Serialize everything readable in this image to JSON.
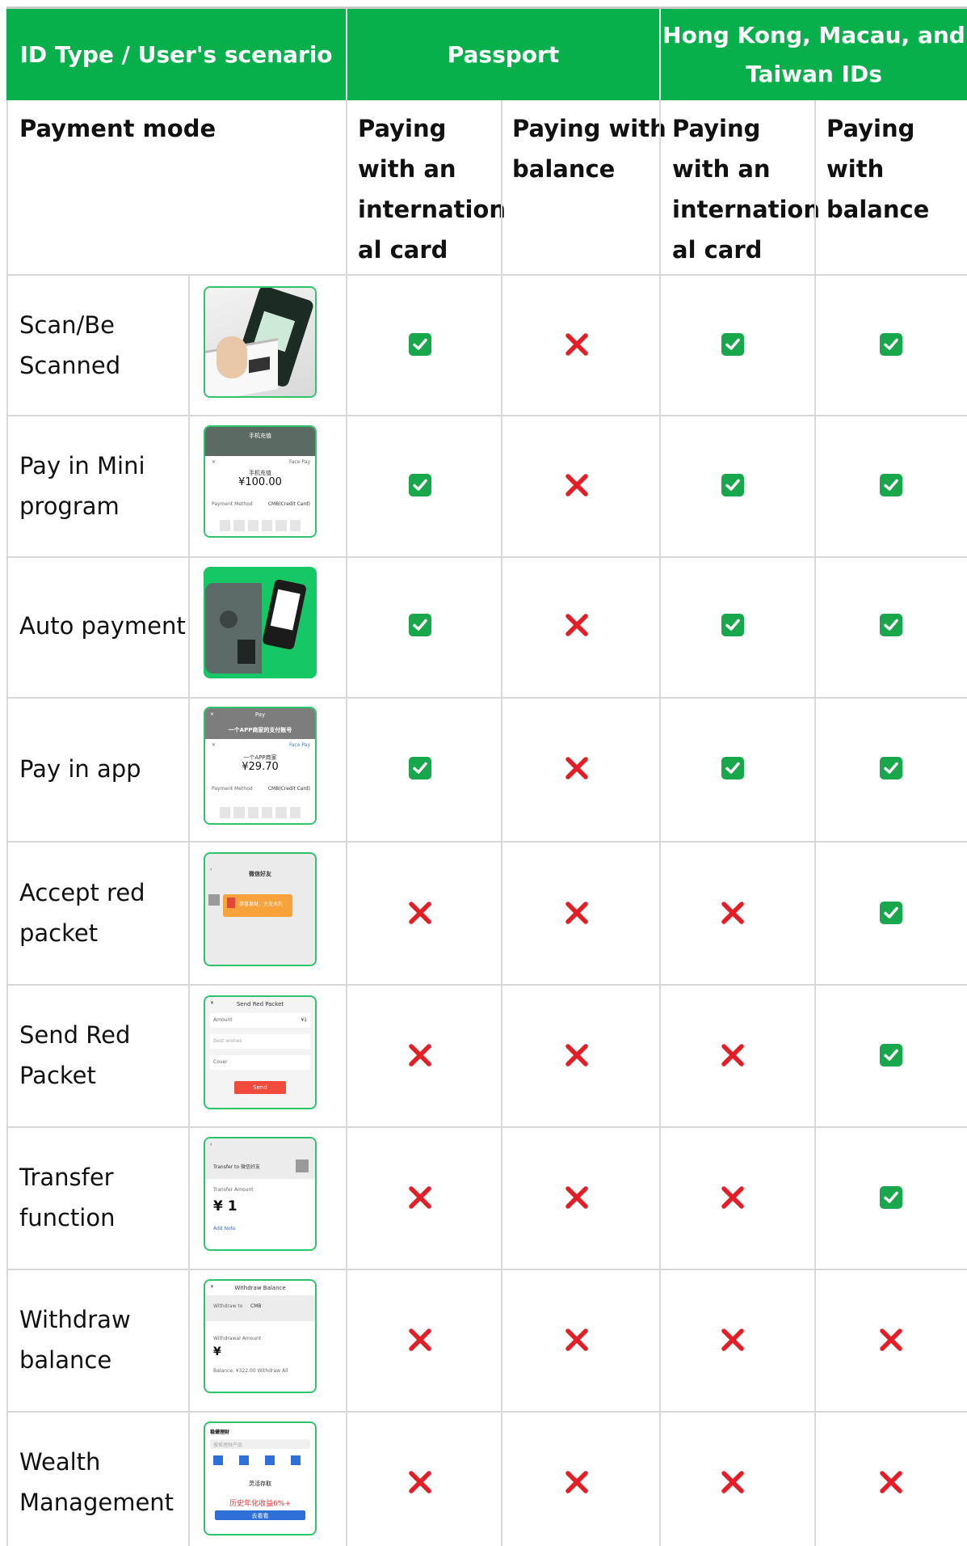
{
  "header": {
    "col1": "ID Type / User's scenario",
    "col2": "Passport",
    "col3_line1": "Hong Kong, Macau, and",
    "col3_line2": "Taiwan IDs"
  },
  "subheader": {
    "mode_label": "Payment mode",
    "p_intl": [
      "Paying",
      "with an",
      "internation",
      "al card"
    ],
    "p_bal": [
      "Paying with",
      "balance"
    ],
    "h_intl": [
      "Paying",
      "with an",
      "internation",
      "al card"
    ],
    "h_bal": [
      "Paying with",
      "balance"
    ]
  },
  "rows": [
    {
      "lines": [
        "Scan/Be",
        "Scanned"
      ],
      "marks": [
        "check",
        "cross",
        "check",
        "check"
      ],
      "thumb": "scan-photo"
    },
    {
      "lines": [
        "Pay in Mini",
        "program"
      ],
      "marks": [
        "check",
        "cross",
        "check",
        "check"
      ],
      "thumb": "mini-program-screen"
    },
    {
      "lines": [
        "Auto payment"
      ],
      "marks": [
        "check",
        "cross",
        "check",
        "check"
      ],
      "thumb": "auto-payment-photo"
    },
    {
      "lines": [
        "Pay in app"
      ],
      "marks": [
        "check",
        "cross",
        "check",
        "check"
      ],
      "thumb": "app-pay-screen"
    },
    {
      "lines": [
        "Accept red",
        "packet"
      ],
      "marks": [
        "cross",
        "cross",
        "cross",
        "check"
      ],
      "thumb": "red-packet-screen"
    },
    {
      "lines": [
        "Send Red",
        "Packet"
      ],
      "marks": [
        "cross",
        "cross",
        "cross",
        "check"
      ],
      "thumb": "send-red-packet-screen"
    },
    {
      "lines": [
        "Transfer",
        "function"
      ],
      "marks": [
        "cross",
        "cross",
        "cross",
        "check"
      ],
      "thumb": "transfer-screen"
    },
    {
      "lines": [
        "Withdraw",
        "balance"
      ],
      "marks": [
        "cross",
        "cross",
        "cross",
        "cross"
      ],
      "thumb": "withdraw-screen"
    },
    {
      "lines": [
        "Wealth",
        "Management"
      ],
      "marks": [
        "cross",
        "cross",
        "cross",
        "cross"
      ],
      "thumb": "wealth-screen"
    }
  ],
  "thumbs": {
    "mini": {
      "title": "手机充值",
      "top": "Face Pay",
      "name": "手机充值",
      "amount": "¥100.00",
      "method": "Payment Method",
      "card": "CMB(Credit Card)"
    },
    "app": {
      "title": "Pay",
      "subtitle": "一个APP商家的支付账号",
      "top": "Face Pay",
      "name": "一个APP商家",
      "amount": "¥29.70",
      "method": "Payment Method",
      "card": "CMB(Credit Card)"
    },
    "red": {
      "title": "微信好友",
      "text": "恭喜发财，大吉大利"
    },
    "send": {
      "title": "Send Red Packet",
      "amount": "Amount",
      "amount_val": "¥1",
      "wish": "Best wishes",
      "cover": "Cover",
      "button": "Send"
    },
    "transfer": {
      "to": "Transfer to 微信好友",
      "label": "Transfer Amount",
      "value": "¥ 1",
      "note": "Add Note"
    },
    "withdraw": {
      "title": "Withdraw Balance",
      "to": "Withdraw to",
      "bank": "CMB",
      "label": "Withdrawal Amount",
      "value": "¥",
      "balance": "Balance: ¥322.00 Withdraw All"
    },
    "wealth": {
      "title": "稳健理财",
      "search": "搜索理财产品",
      "banner": "灵活存取",
      "rate": "历史年化收益6%+",
      "button": "去看看"
    }
  },
  "colors": {
    "header_bg": "#08b04b",
    "check": "#18a74a",
    "cross": "#e41e26",
    "red_packet": "#f7a23b",
    "send_button": "#f04b3c"
  }
}
